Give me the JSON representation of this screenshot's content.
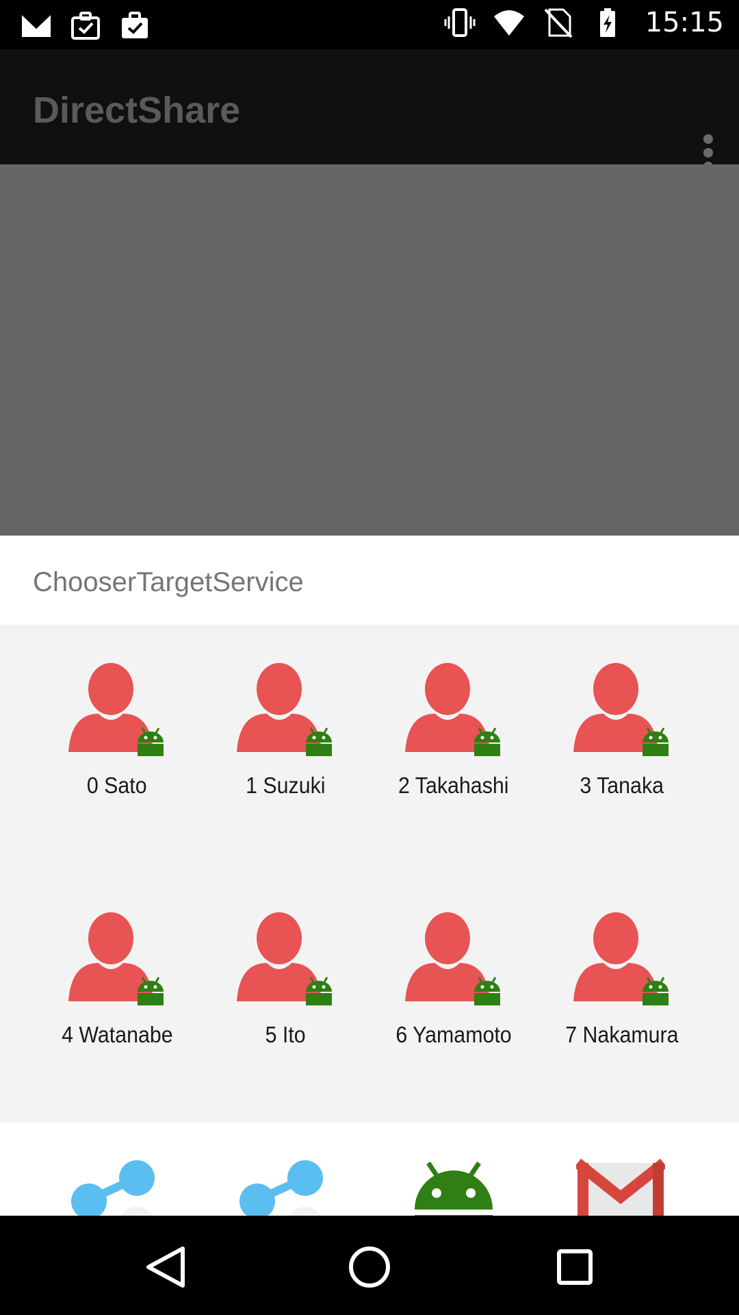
{
  "status_bar": {
    "time": "15:15",
    "left_icons": [
      "gmail-icon",
      "work-briefcase-check-icon",
      "work-briefcase-check-icon"
    ],
    "right_icons": [
      "vibrate-icon",
      "wifi-icon",
      "no-sim-icon",
      "battery-charging-icon"
    ]
  },
  "app_bar": {
    "title": "DirectShare",
    "overflow_icon": "more-vert-icon"
  },
  "chooser": {
    "header_label": "ChooserTargetService",
    "targets": [
      {
        "name": "0 Sato"
      },
      {
        "name": "1 Suzuki"
      },
      {
        "name": "2 Takahashi"
      },
      {
        "name": "3 Tanaka"
      },
      {
        "name": "4 Watanabe"
      },
      {
        "name": "5 Ito"
      },
      {
        "name": "6 Yamamoto"
      },
      {
        "name": "7 Nakamura"
      }
    ],
    "apps": [
      "share-icon",
      "share-icon",
      "android-icon",
      "gmail-icon"
    ]
  },
  "colors": {
    "avatar": "#e85353",
    "badge": "#2f7f14",
    "share": "#5bbef0",
    "gmail": "#d7463d"
  },
  "nav_bar": {
    "buttons": [
      "back-icon",
      "home-icon",
      "recents-icon"
    ]
  }
}
